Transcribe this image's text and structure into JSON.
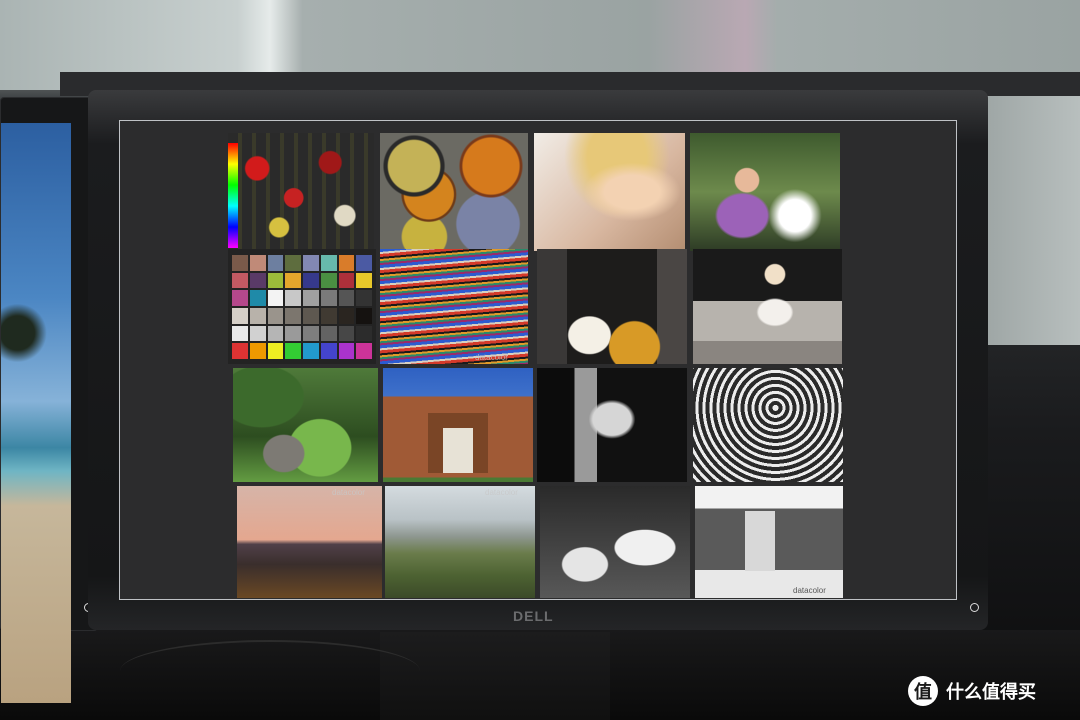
{
  "monitor": {
    "brand": "DELL"
  },
  "watermark": {
    "text": "什么值得买",
    "icon": "值"
  },
  "tile_watermark": "datacolor",
  "checker_colors": [
    "#7a5a4a",
    "#c08a78",
    "#6d7fa0",
    "#5e6d3e",
    "#8288b3",
    "#67b9ac",
    "#d97c2a",
    "#4b5aa3",
    "#c25a63",
    "#5a3a67",
    "#9cbc3a",
    "#e4a62c",
    "#36398c",
    "#4a8f42",
    "#ad303a",
    "#e8c82a",
    "#b5488b",
    "#1f8aa8",
    "#f3f3f3",
    "#c8c8c8",
    "#a0a0a0",
    "#7a7a7a",
    "#555555",
    "#333333",
    "#d6d0c8",
    "#b8b2aa",
    "#9a948c",
    "#7c766e",
    "#5e5850",
    "#403a32",
    "#2a2520",
    "#151210",
    "#e9e9e9",
    "#d1d1d1",
    "#b5b5b5",
    "#9a9a9a",
    "#7e7e7e",
    "#636363",
    "#474747",
    "#2c2c2c",
    "#d33",
    "#e90",
    "#ee2",
    "#3c3",
    "#29c",
    "#44c",
    "#a3c",
    "#c39"
  ]
}
